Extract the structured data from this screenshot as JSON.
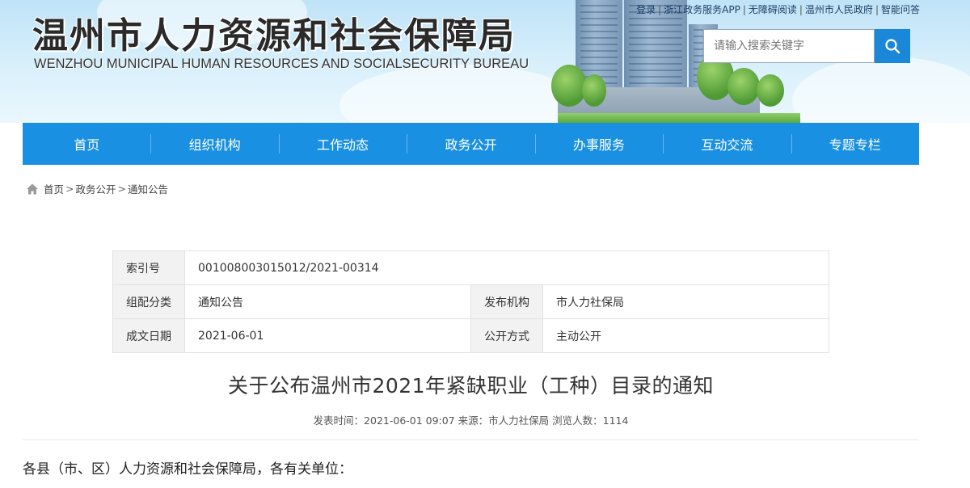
{
  "header": {
    "title_cn": "温州市人力资源和社会保障局",
    "title_en": "WENZHOU MUNICIPAL HUMAN RESOURCES AND SOCIALSECURITY BUREAU",
    "top_links": [
      "登录",
      "浙江政务服务APP",
      "无障碍阅读",
      "温州市人民政府",
      "智能问答"
    ],
    "search": {
      "placeholder": "请输入搜索关键字",
      "icon": "search-icon"
    }
  },
  "nav": {
    "items": [
      "首页",
      "组织机构",
      "工作动态",
      "政务公开",
      "办事服务",
      "互动交流",
      "专题专栏"
    ]
  },
  "breadcrumb": {
    "icon": "home-icon",
    "items": [
      "首页",
      "政务公开",
      "通知公告"
    ],
    "separator": ">"
  },
  "info": {
    "index_label": "索引号",
    "index_value": "001008003015012/2021-00314",
    "category_label": "组配分类",
    "category_value": "通知公告",
    "publisher_label": "发布机构",
    "publisher_value": "市人力社保局",
    "date_label": "成文日期",
    "date_value": "2021-06-01",
    "disclosure_label": "公开方式",
    "disclosure_value": "主动公开"
  },
  "article": {
    "title": "关于公布温州市2021年紧缺职业（工种）目录的通知",
    "meta": "发表时间：2021-06-01 09:07 来源：市人力社保局 浏览人数：1114",
    "salutation": "各县（市、区）人力资源和社会保障局，各有关单位："
  },
  "colors": {
    "nav_bg": "#1a90e2",
    "search_btn": "#1a87d8",
    "table_label_bg": "#f2f2f2"
  }
}
